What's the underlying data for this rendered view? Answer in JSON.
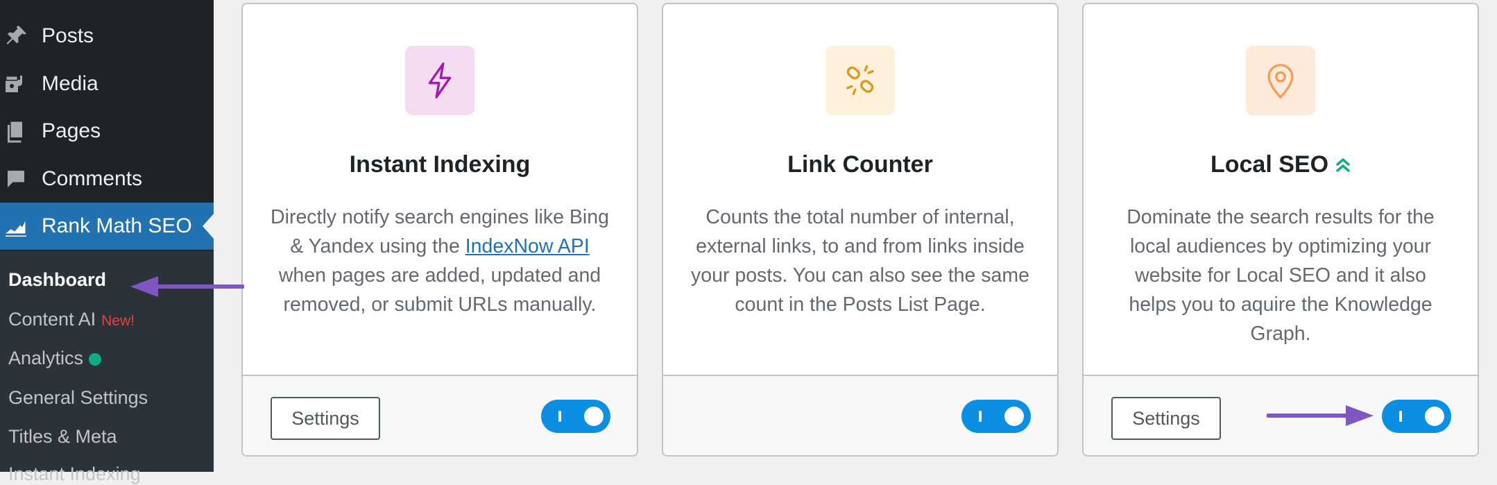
{
  "sidebar": {
    "menu": [
      {
        "label": "Posts",
        "icon": "pin-icon"
      },
      {
        "label": "Media",
        "icon": "media-icon"
      },
      {
        "label": "Pages",
        "icon": "pages-icon"
      },
      {
        "label": "Comments",
        "icon": "comment-icon"
      },
      {
        "label": "Rank Math SEO",
        "icon": "rank-math-icon",
        "current": true
      }
    ],
    "submenu": [
      {
        "label": "Dashboard",
        "active": true
      },
      {
        "label": "Content AI",
        "badge": "New!"
      },
      {
        "label": "Analytics",
        "status_dot": "#10ac84"
      },
      {
        "label": "General Settings"
      },
      {
        "label": "Titles & Meta"
      },
      {
        "label": "Instant Indexing"
      }
    ]
  },
  "cards": [
    {
      "title": "Instant Indexing",
      "icon": "lightning-icon",
      "icon_bg": "#f4dcf3",
      "icon_color": "#a21caf",
      "desc_before": "Directly notify search engines like Bing & Yandex using the ",
      "link": "IndexNow API",
      "desc_after": " when pages are added, updated and removed, or submit URLs manually.",
      "settings_label": "Settings",
      "enabled": true
    },
    {
      "title": "Link Counter",
      "icon": "broken-link-icon",
      "icon_bg": "#fdf1dc",
      "icon_color": "#d99a1f",
      "desc": "Counts the total number of internal, external links, to and from links inside your posts. You can also see the same count in the Posts List Page.",
      "enabled": true
    },
    {
      "title": "Local SEO",
      "icon": "location-pin-icon",
      "icon_bg": "#fdeadb",
      "icon_color": "#f59e5a",
      "title_badge": "chevron-double-up-icon",
      "title_badge_color": "#10ac84",
      "desc": "Dominate the search results for the local audiences by optimizing your website for Local SEO and it also helps you to aquire the Knowledge Graph.",
      "settings_label": "Settings",
      "enabled": true
    }
  ],
  "colors": {
    "toggle_on": "#0a8fe2",
    "annotation_arrow": "#7e57c2",
    "menu_current": "#2271b1"
  }
}
